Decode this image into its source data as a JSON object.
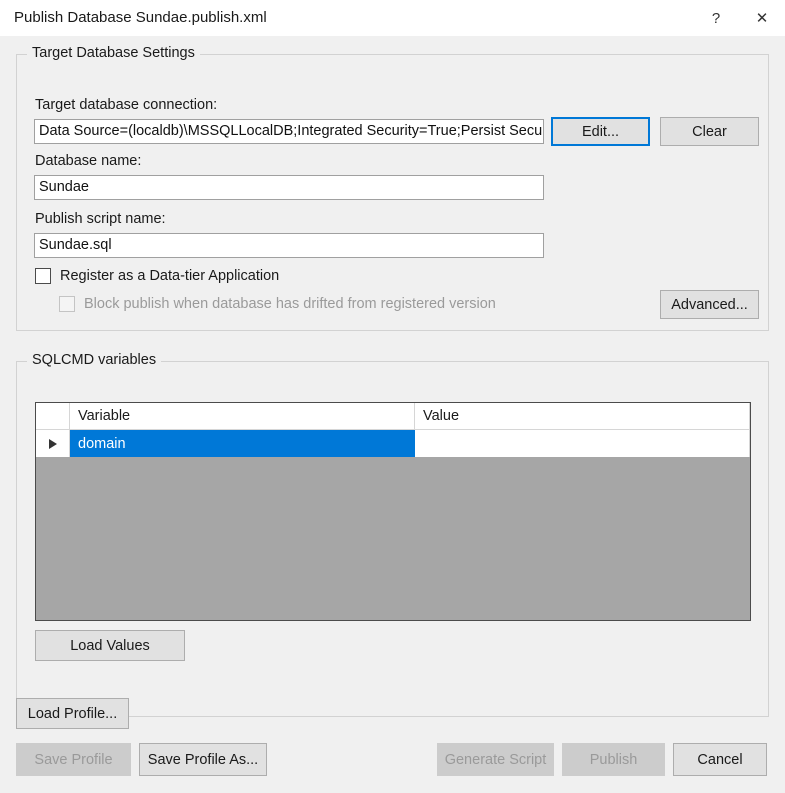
{
  "window": {
    "title": "Publish Database Sundae.publish.xml",
    "help_label": "?",
    "close_label": "✕"
  },
  "target_group": {
    "legend": "Target Database Settings",
    "connection_label": "Target database connection:",
    "connection_value": "Data Source=(localdb)\\MSSQLLocalDB;Integrated Security=True;Persist Secu",
    "edit_label": "Edit...",
    "clear_label": "Clear",
    "database_name_label": "Database name:",
    "database_name_value": "Sundae",
    "publish_script_label": "Publish script name:",
    "publish_script_value": "Sundae.sql",
    "register_dac_label": "Register as a Data-tier Application",
    "register_dac_checked": false,
    "block_publish_label": "Block publish when database has drifted from registered version",
    "block_publish_checked": false,
    "block_publish_disabled": true,
    "advanced_label": "Advanced..."
  },
  "sqlcmd_group": {
    "legend": "SQLCMD variables",
    "columns": [
      "",
      "Variable",
      "Value"
    ],
    "rows": [
      {
        "selector": "▶",
        "variable": "domain",
        "value": ""
      }
    ],
    "load_values_label": "Load Values"
  },
  "footer": {
    "load_profile_label": "Load Profile...",
    "save_profile_label": "Save Profile",
    "save_profile_disabled": true,
    "save_profile_as_label": "Save Profile As...",
    "generate_script_label": "Generate Script",
    "generate_script_disabled": true,
    "publish_label": "Publish",
    "publish_disabled": true,
    "cancel_label": "Cancel"
  },
  "colors": {
    "accent": "#0078d7",
    "dialog_background": "#f0f0f0",
    "titlebar_background": "#ffffff",
    "grid_empty": "#a6a6a6",
    "disabled_text": "#9a9a9a"
  }
}
